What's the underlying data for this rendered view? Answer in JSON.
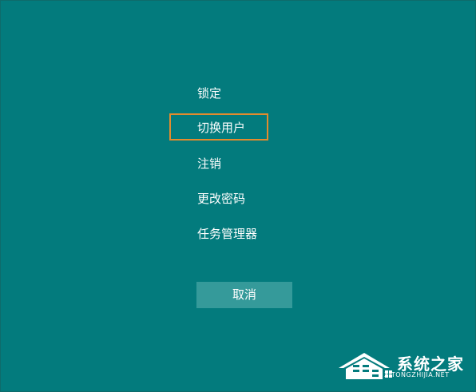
{
  "menu": {
    "items": [
      {
        "label": "锁定"
      },
      {
        "label": "切换用户",
        "focused": true
      },
      {
        "label": "注销"
      },
      {
        "label": "更改密码"
      },
      {
        "label": "任务管理器"
      }
    ],
    "cancel_label": "取消"
  },
  "watermark": {
    "title": "系统之家",
    "url": "XITONGZHIJIA.NET"
  },
  "colors": {
    "background": "#037b7d",
    "cancel_button": "#359a9a",
    "focus_outline": "#e38b2d",
    "text": "#ffffff"
  }
}
